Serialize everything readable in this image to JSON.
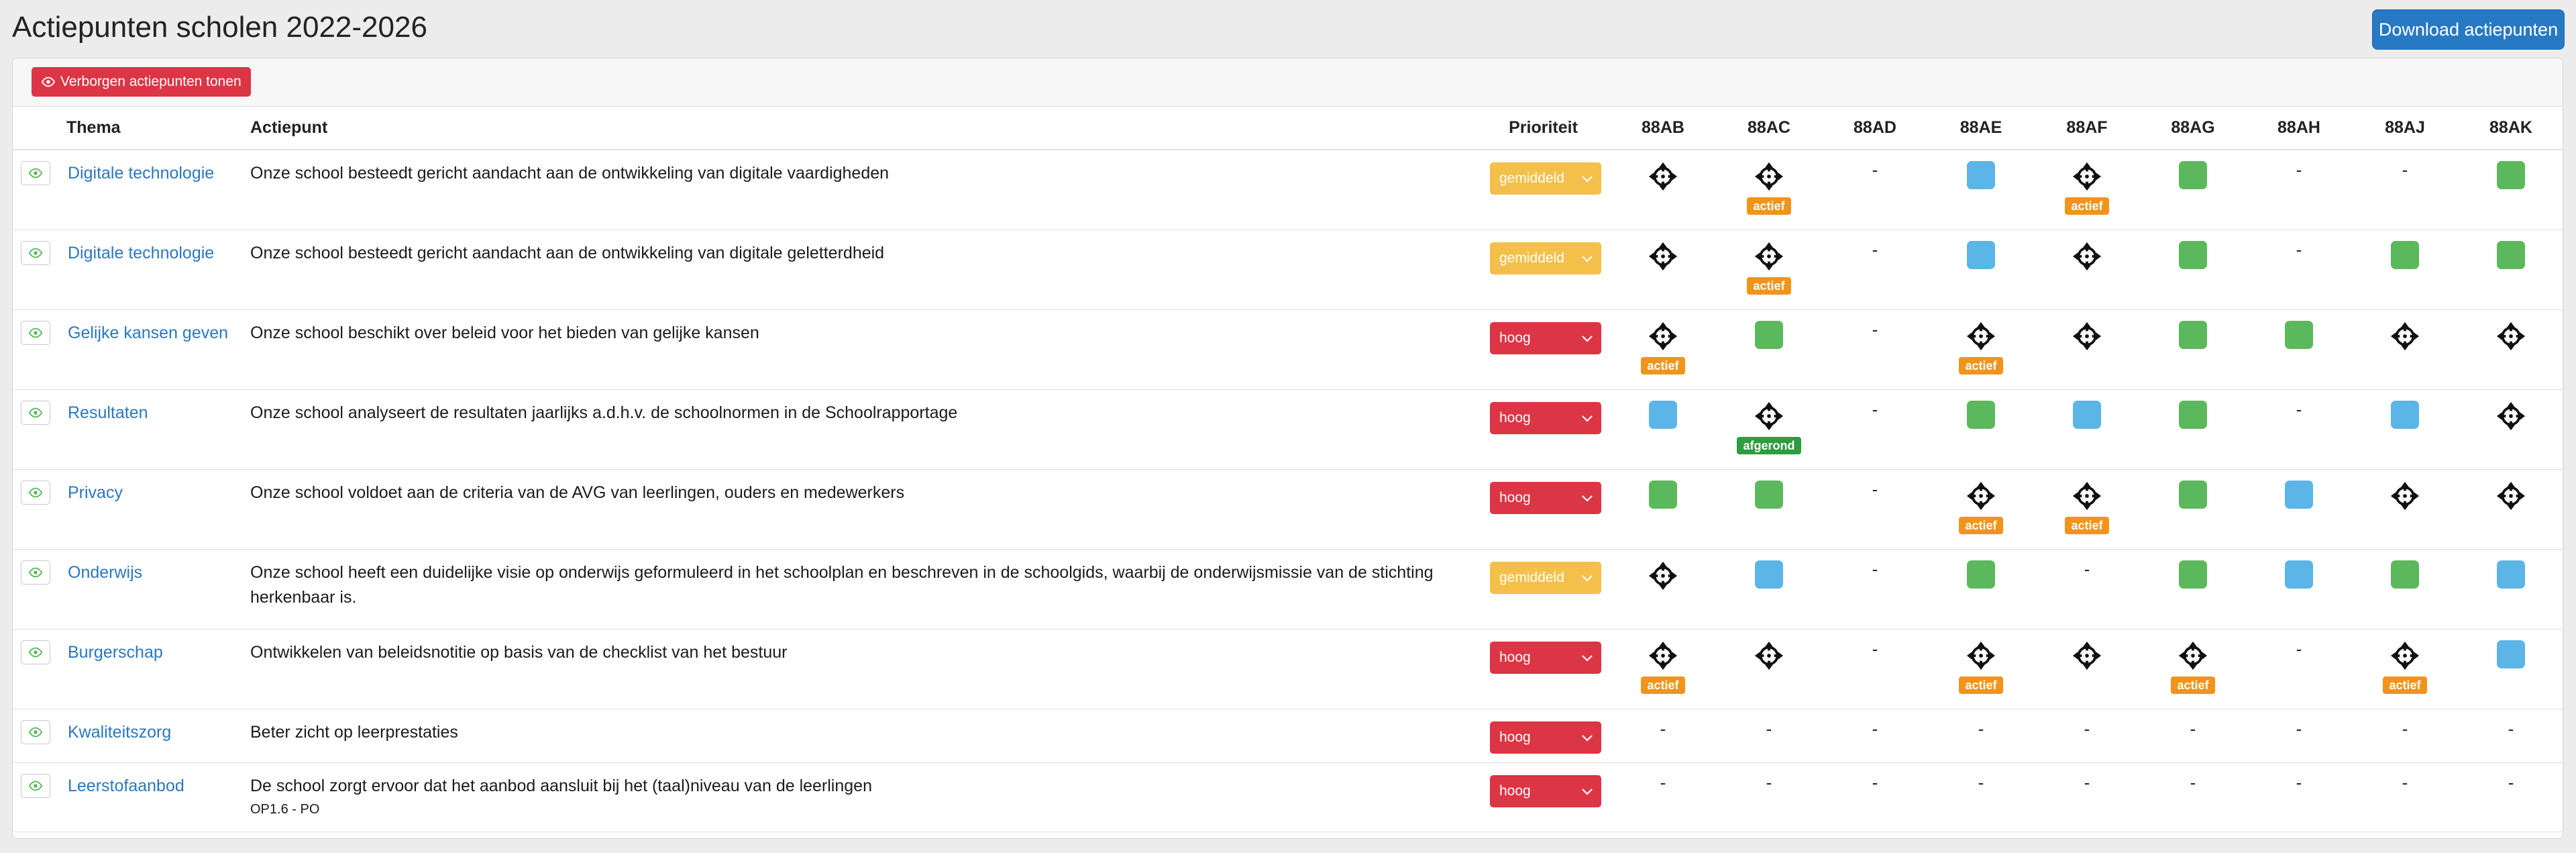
{
  "page": {
    "title": "Actiepunten scholen 2022-2026",
    "download_label": "Download actiepunten"
  },
  "toolbar": {
    "toggle_hidden_label": "Verborgen actiepunten tonen"
  },
  "table": {
    "headers": {
      "thema": "Thema",
      "actiepunt": "Actiepunt",
      "prioriteit": "Prioriteit"
    },
    "schools": [
      "88AB",
      "88AC",
      "88AD",
      "88AE",
      "88AF",
      "88AG",
      "88AH",
      "88AJ",
      "88AK"
    ],
    "rows": [
      {
        "thema": "Digitale technologie",
        "actiepunt": "Onze school besteedt gericht aandacht aan de ontwikkeling van digitale vaardigheden",
        "sub": "",
        "prioriteit": "gemiddeld",
        "status": [
          [
            "target",
            ""
          ],
          [
            "target",
            "actief"
          ],
          [
            "dash",
            ""
          ],
          [
            "blue",
            ""
          ],
          [
            "target",
            "actief"
          ],
          [
            "green",
            ""
          ],
          [
            "dash",
            ""
          ],
          [
            "dash",
            ""
          ],
          [
            "green",
            ""
          ]
        ]
      },
      {
        "thema": "Digitale technologie",
        "actiepunt": "Onze school besteedt gericht aandacht aan de ontwikkeling van digitale geletterdheid",
        "sub": "",
        "prioriteit": "gemiddeld",
        "status": [
          [
            "target",
            ""
          ],
          [
            "target",
            "actief"
          ],
          [
            "dash",
            ""
          ],
          [
            "blue",
            ""
          ],
          [
            "target",
            ""
          ],
          [
            "green",
            ""
          ],
          [
            "dash",
            ""
          ],
          [
            "green",
            ""
          ],
          [
            "green",
            ""
          ]
        ]
      },
      {
        "thema": "Gelijke kansen geven",
        "actiepunt": "Onze school beschikt over beleid voor het bieden van gelijke kansen",
        "sub": "",
        "prioriteit": "hoog",
        "status": [
          [
            "target",
            "actief"
          ],
          [
            "green",
            ""
          ],
          [
            "dash",
            ""
          ],
          [
            "target",
            "actief"
          ],
          [
            "target",
            ""
          ],
          [
            "green",
            ""
          ],
          [
            "green",
            ""
          ],
          [
            "target",
            ""
          ],
          [
            "target",
            ""
          ]
        ]
      },
      {
        "thema": "Resultaten",
        "actiepunt": "Onze school analyseert de resultaten jaarlijks a.d.h.v. de schoolnormen in de Schoolrapportage",
        "sub": "",
        "prioriteit": "hoog",
        "status": [
          [
            "blue",
            ""
          ],
          [
            "target",
            "afgerond"
          ],
          [
            "dash",
            ""
          ],
          [
            "green",
            ""
          ],
          [
            "blue",
            ""
          ],
          [
            "green",
            ""
          ],
          [
            "dash",
            ""
          ],
          [
            "blue",
            ""
          ],
          [
            "target",
            ""
          ]
        ]
      },
      {
        "thema": "Privacy",
        "actiepunt": "Onze school voldoet aan de criteria van de AVG van leerlingen, ouders en medewerkers",
        "sub": "",
        "prioriteit": "hoog",
        "status": [
          [
            "green",
            ""
          ],
          [
            "green",
            ""
          ],
          [
            "dash",
            ""
          ],
          [
            "target",
            "actief"
          ],
          [
            "target",
            "actief"
          ],
          [
            "green",
            ""
          ],
          [
            "blue",
            ""
          ],
          [
            "target",
            ""
          ],
          [
            "target",
            ""
          ]
        ]
      },
      {
        "thema": "Onderwijs",
        "actiepunt": "Onze school heeft een duidelijke visie op onderwijs geformuleerd in het schoolplan en beschreven in de schoolgids, waarbij de onderwijsmissie van de stichting herkenbaar is.",
        "sub": "",
        "prioriteit": "gemiddeld",
        "status": [
          [
            "target",
            ""
          ],
          [
            "blue",
            ""
          ],
          [
            "dash",
            ""
          ],
          [
            "green",
            ""
          ],
          [
            "dash",
            ""
          ],
          [
            "green",
            ""
          ],
          [
            "blue",
            ""
          ],
          [
            "green",
            ""
          ],
          [
            "blue",
            ""
          ]
        ]
      },
      {
        "thema": "Burgerschap",
        "actiepunt": "Ontwikkelen van beleidsnotitie op basis van de checklist van het bestuur",
        "sub": "",
        "prioriteit": "hoog",
        "status": [
          [
            "target",
            "actief"
          ],
          [
            "target",
            ""
          ],
          [
            "dash",
            ""
          ],
          [
            "target",
            "actief"
          ],
          [
            "target",
            ""
          ],
          [
            "target",
            "actief"
          ],
          [
            "dash",
            ""
          ],
          [
            "target",
            "actief"
          ],
          [
            "blue",
            ""
          ]
        ]
      },
      {
        "thema": "Kwaliteitszorg",
        "actiepunt": "Beter zicht op leerprestaties",
        "sub": "",
        "prioriteit": "hoog",
        "status": [
          [
            "dash",
            ""
          ],
          [
            "dash",
            ""
          ],
          [
            "dash",
            ""
          ],
          [
            "dash",
            ""
          ],
          [
            "dash",
            ""
          ],
          [
            "dash",
            ""
          ],
          [
            "dash",
            ""
          ],
          [
            "dash",
            ""
          ],
          [
            "dash",
            ""
          ]
        ]
      },
      {
        "thema": "Leerstofaanbod",
        "actiepunt": "De school zorgt ervoor dat het aanbod aansluit bij het (taal)niveau van de leerlingen",
        "sub": "OP1.6 - PO",
        "prioriteit": "hoog",
        "status": [
          [
            "dash",
            ""
          ],
          [
            "dash",
            ""
          ],
          [
            "dash",
            ""
          ],
          [
            "dash",
            ""
          ],
          [
            "dash",
            ""
          ],
          [
            "dash",
            ""
          ],
          [
            "dash",
            ""
          ],
          [
            "dash",
            ""
          ],
          [
            "dash",
            ""
          ]
        ]
      }
    ],
    "dash_symbol": "-"
  },
  "colors": {
    "primary": "#2779c4",
    "danger": "#dc3545",
    "warning": "#f5c04a",
    "green": "#5cb85c",
    "blue": "#5bb5e6",
    "actief": "#f0941c",
    "afgerond": "#2e9c3f",
    "link": "#2b77c0"
  }
}
